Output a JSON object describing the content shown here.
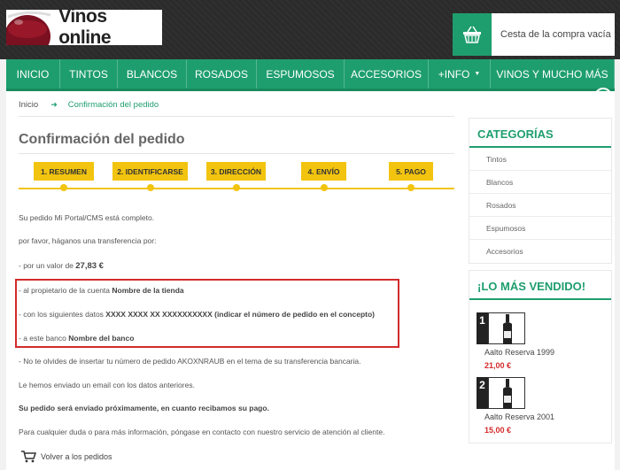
{
  "header": {
    "logo_text": "Vinos online",
    "cart_text": "Cesta de la compra vacía"
  },
  "nav": {
    "items": [
      {
        "label": "INICIO",
        "w": 61
      },
      {
        "label": "TINTOS",
        "w": 65
      },
      {
        "label": "BLANCOS",
        "w": 78
      },
      {
        "label": "ROSADOS",
        "w": 79
      },
      {
        "label": "ESPUMOSOS",
        "w": 99
      },
      {
        "label": "ACCESORIOS",
        "w": 95
      },
      {
        "label": "+INFO",
        "w": 70,
        "dropdown": true
      },
      {
        "label": "VINOS Y MUCHO MÁS",
        "w": 140
      }
    ]
  },
  "breadcrumb": {
    "home": "Inicio",
    "current": "Confirmación del pedido"
  },
  "page": {
    "title": "Confirmación del pedido"
  },
  "steps": [
    "1. RESUMEN",
    "2. IDENTIFICARSE",
    "3. DIRECCIÓN",
    "4. ENVÍO",
    "5. PAGO"
  ],
  "content": {
    "complete": "Su pedido Mi Portal/CMS está completo.",
    "transfer_intro": "por favor, háganos una transferencia por:",
    "amount_prefix": "- por un valor de ",
    "amount": "27,83 €",
    "owner_prefix": "- al propietario de la cuenta ",
    "owner": "Nombre de la tienda",
    "data_prefix": "- con los siguientes datos ",
    "data": "XXXX XXXX XX XXXXXXXXXX (indicar el número de pedido en el concepto)",
    "bank_prefix": "- a este banco ",
    "bank": "Nombre del banco",
    "reminder": "- No te olvides de insertar tu número de pedido AKOXNRAUB en el tema de su transferencia bancaria.",
    "email_sent": "Le hemos enviado un email con los datos anteriores.",
    "shipping_note": "Su pedido será enviado próximamente, en cuanto recibamos su pago.",
    "contact_prefix": "Para cualquier duda o para más información, póngase en contacto con nuestro servicio de ",
    "contact_link": "atención al cliente",
    "contact_suffix": ".",
    "back_link": "Volver a los pedidos"
  },
  "sidebar": {
    "categories_title": "CATEGORÍAS",
    "categories": [
      "Tintos",
      "Blancos",
      "Rosados",
      "Espumosos",
      "Accesorios"
    ],
    "bestsellers_title": "¡LO MÁS VENDIDO!",
    "bestsellers": [
      {
        "rank": "1",
        "name": "Aalto Reserva 1999",
        "price": "21,00 €"
      },
      {
        "rank": "2",
        "name": "Aalto Reserva 2001",
        "price": "15,00 €"
      }
    ]
  },
  "colors": {
    "accent": "#1e9e6e",
    "steps": "#f2c40f",
    "highlight": "#d32b2b",
    "price": "#d32b2b"
  }
}
